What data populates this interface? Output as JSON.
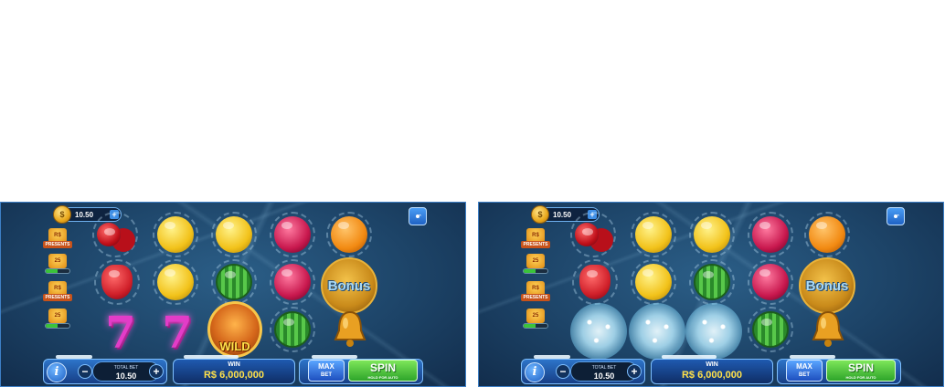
{
  "panels": [
    {
      "balance": "10.50",
      "gifts": [
        {
          "type": "presents",
          "label": "R$",
          "tag": "PRESENTS"
        },
        {
          "type": "progress",
          "label": "25",
          "progress": 0.5
        },
        {
          "type": "presents",
          "label": "R$",
          "tag": "PRESENTS"
        },
        {
          "type": "progress",
          "label": "25",
          "progress": 0.5
        }
      ],
      "wild_label": "WILD",
      "bonus_label": "Bonus",
      "total_bet_label": "TOTAL BET",
      "total_bet": "10.50",
      "win_label": "WIN",
      "win_amount": "R$  6,000,000",
      "max_bet_line1": "MAX",
      "max_bet_line2": "BET",
      "spin_label": "SPIN",
      "spin_hint": "HOLD FOR AUTO"
    },
    {
      "balance": "10.50",
      "gifts": [
        {
          "type": "presents",
          "label": "R$",
          "tag": "PRESENTS"
        },
        {
          "type": "progress",
          "label": "25",
          "progress": 0.5
        },
        {
          "type": "presents",
          "label": "R$",
          "tag": "PRESENTS"
        },
        {
          "type": "progress",
          "label": "25",
          "progress": 0.5
        }
      ],
      "bonus_label": "Bonus",
      "total_bet_label": "TOTAL BET",
      "total_bet": "10.50",
      "win_label": "WIN",
      "win_amount": "R$  6,000,000",
      "max_bet_line1": "MAX",
      "max_bet_line2": "BET",
      "spin_label": "SPIN",
      "spin_hint": "HOLD FOR AUTO"
    }
  ],
  "coin_symbol": "$",
  "info_symbol": "i",
  "plus_symbol": "+",
  "minus_symbol": "−",
  "colors": {
    "background": "#1d4468",
    "accent": "#3d7fc6",
    "win": "#ffe14a",
    "spin": "#2ea52a",
    "seven": "#e33cc8"
  }
}
